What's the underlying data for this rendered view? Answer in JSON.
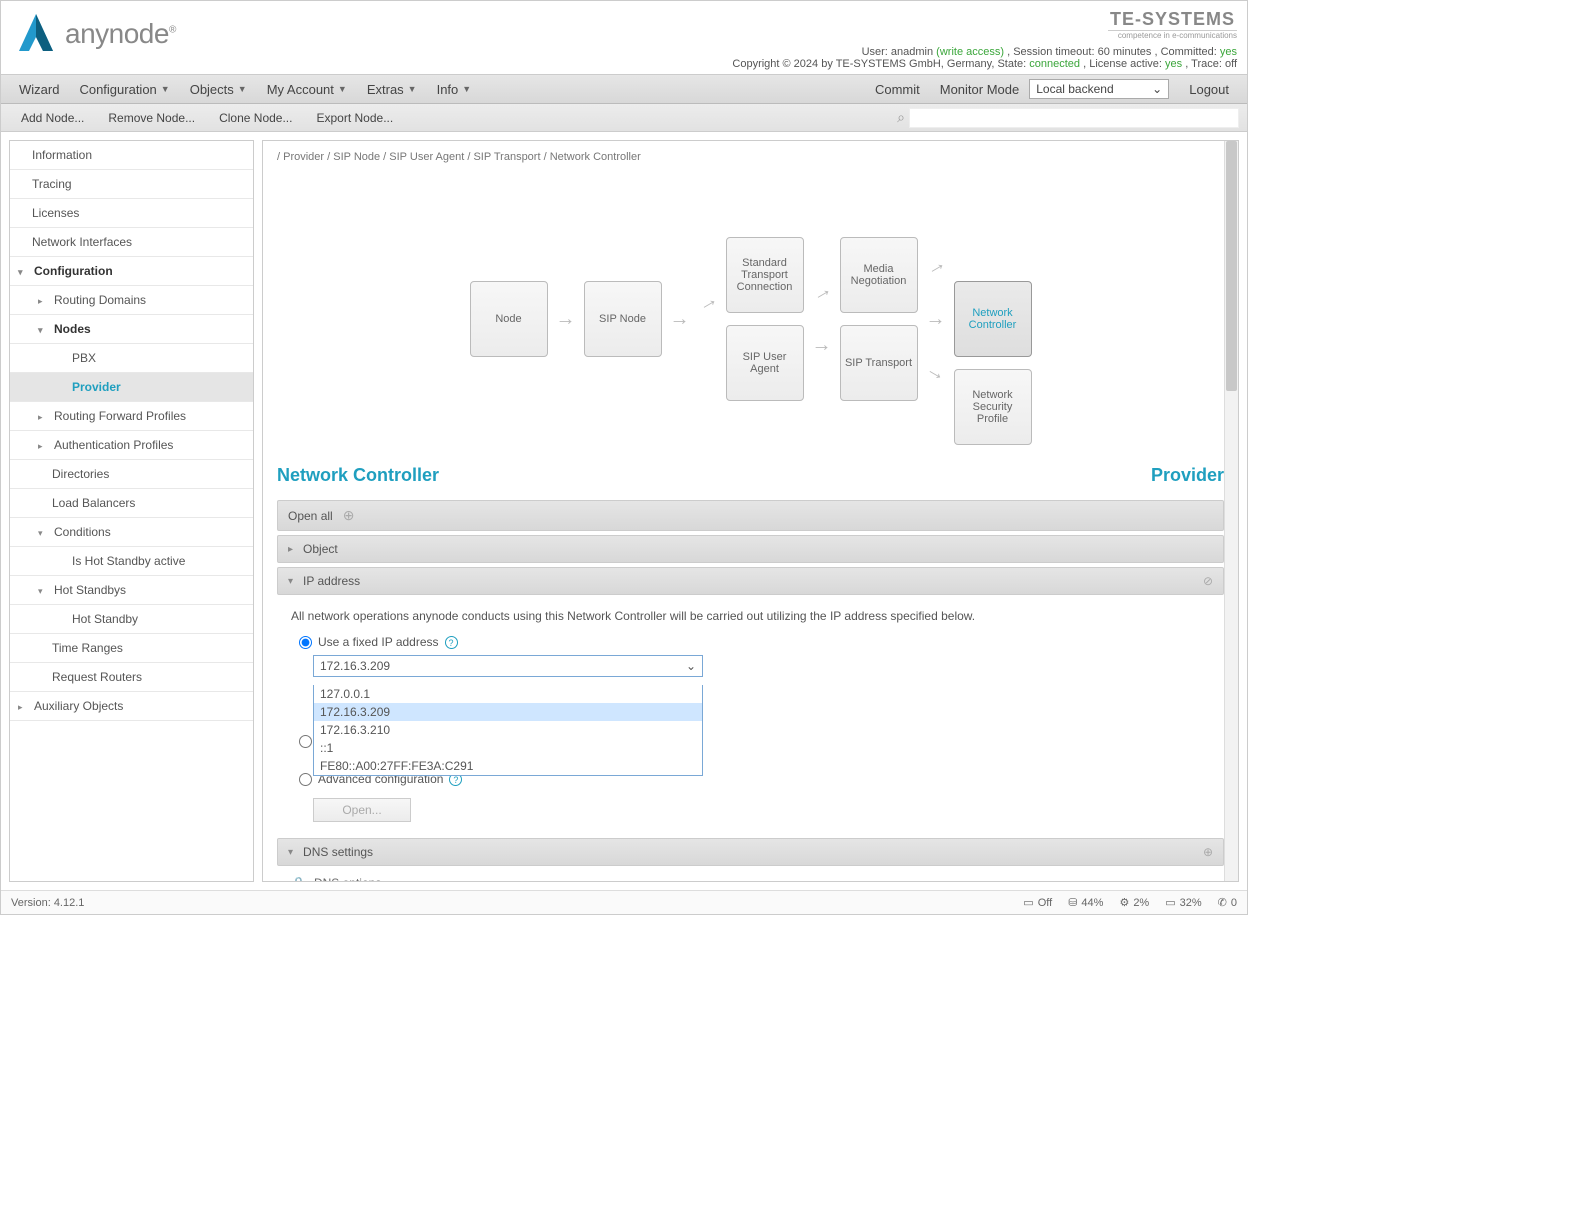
{
  "header": {
    "brand": "anynode",
    "te_brand": "TE-SYSTEMS",
    "te_sub": "competence in e-communications",
    "user_label": "User:",
    "user_name": "anadmin",
    "write_access": "(write access)",
    "session_label": ", Session timeout:",
    "session_value": "60 minutes",
    "committed_label": ", Committed:",
    "committed_value": "yes",
    "copyright": "Copyright © 2024 by TE-SYSTEMS GmbH, Germany, State:",
    "state_value": "connected",
    "license_label": ", License active:",
    "license_value": "yes",
    "trace_label": ", Trace:",
    "trace_value": "off"
  },
  "toolbar1": {
    "wizard": "Wizard",
    "configuration": "Configuration",
    "objects": "Objects",
    "my_account": "My Account",
    "extras": "Extras",
    "info": "Info",
    "commit": "Commit",
    "monitor": "Monitor Mode",
    "backend": "Local backend",
    "logout": "Logout"
  },
  "toolbar2": {
    "add_node": "Add Node...",
    "remove_node": "Remove Node...",
    "clone_node": "Clone Node...",
    "export_node": "Export Node..."
  },
  "sidebar": {
    "information": "Information",
    "tracing": "Tracing",
    "licenses": "Licenses",
    "network_interfaces": "Network Interfaces",
    "configuration": "Configuration",
    "routing_domains": "Routing Domains",
    "nodes": "Nodes",
    "pbx": "PBX",
    "provider": "Provider",
    "routing_forward": "Routing Forward Profiles",
    "auth_profiles": "Authentication Profiles",
    "directories": "Directories",
    "load_balancers": "Load Balancers",
    "conditions": "Conditions",
    "hot_standby_active": "Is Hot Standby active",
    "hot_standbys": "Hot Standbys",
    "hot_standby": "Hot Standby",
    "time_ranges": "Time Ranges",
    "request_routers": "Request Routers",
    "aux_objects": "Auxiliary Objects"
  },
  "breadcrumb": "/ Provider / SIP Node / SIP User Agent / SIP Transport / Network Controller",
  "flow": {
    "node": "Node",
    "sip_node": "SIP Node",
    "std_transport": "Standard Transport Connection",
    "sip_user_agent": "SIP User Agent",
    "media_neg": "Media Negotiation",
    "sip_transport": "SIP Transport",
    "net_controller": "Network Controller",
    "net_sec_profile": "Network Security Profile"
  },
  "page": {
    "title": "Network Controller",
    "subtitle": "Provider",
    "open_all": "Open all",
    "object": "Object",
    "ip_address": "IP address",
    "ip_desc": "All network operations anynode conducts using this Network Controller will be carried out utilizing the IP address specified below.",
    "use_fixed": "Use a fixed IP address",
    "selected_ip": "172.16.3.209",
    "advanced": "Advanced configuration",
    "open_btn": "Open...",
    "dns_settings": "DNS settings",
    "dns_options": "DNS options"
  },
  "dropdown_options": [
    "127.0.0.1",
    "172.16.3.209",
    "172.16.3.210",
    "::1",
    "FE80::A00:27FF:FE3A:C291"
  ],
  "footer": {
    "version_label": "Version:",
    "version": "4.12.1",
    "off": "Off",
    "pct1": "44%",
    "pct2": "2%",
    "pct3": "32%",
    "count": "0"
  }
}
